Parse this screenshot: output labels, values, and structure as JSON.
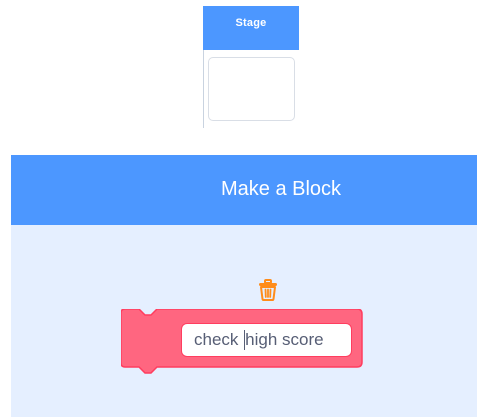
{
  "stage_panel": {
    "tab_label": "Stage"
  },
  "dialog": {
    "title": "Make a Block",
    "block": {
      "text_before_caret": "check ",
      "text_after_caret": "high score"
    }
  },
  "colors": {
    "header_blue": "#4c97ff",
    "dialog_bg": "#e5efff",
    "block_fill": "#ff6680",
    "block_border": "#ff3d5f",
    "trash_orange": "#ff8c1a"
  },
  "icons": {
    "trash": "trash-icon"
  }
}
